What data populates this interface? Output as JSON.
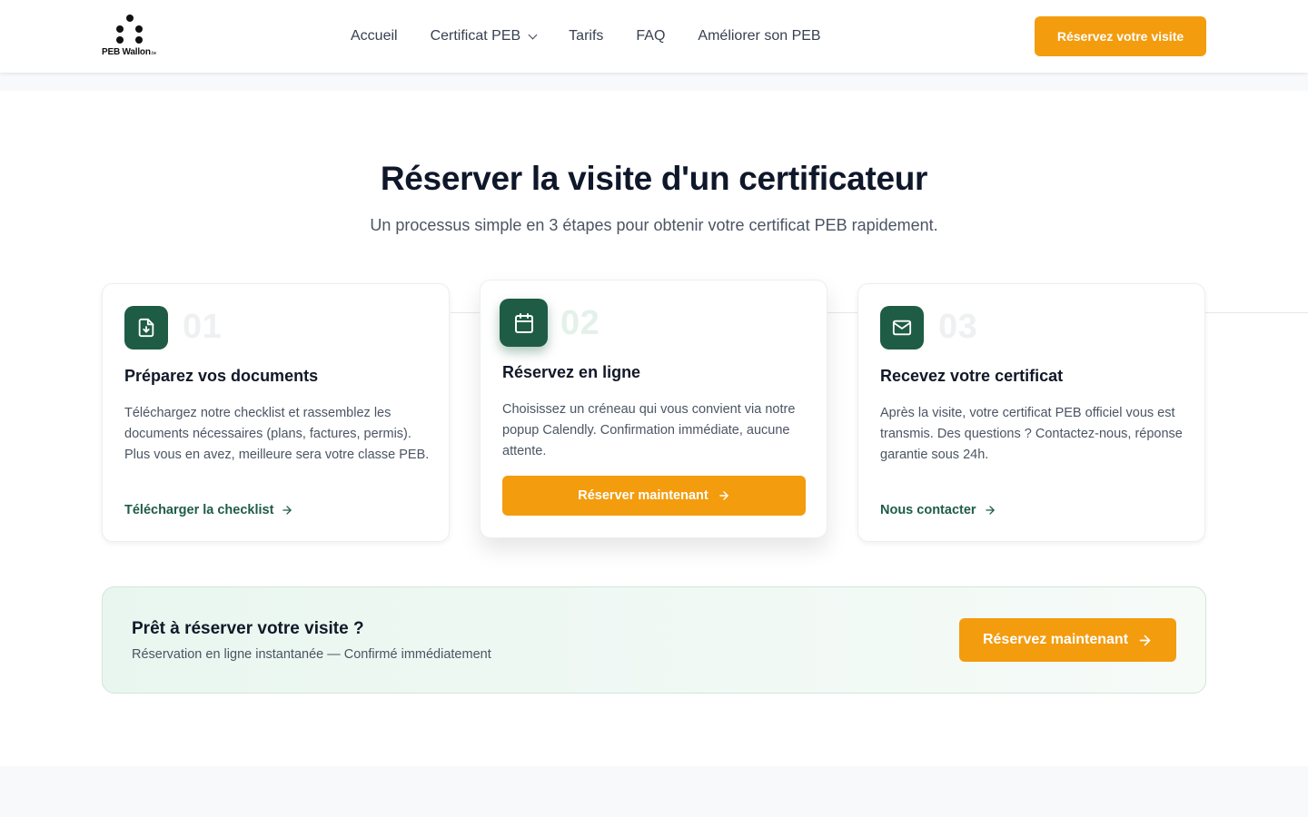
{
  "header": {
    "logo_text": "PEB Wallon",
    "logo_suffix": ".be",
    "nav": [
      {
        "label": "Accueil"
      },
      {
        "label": "Certificat PEB",
        "has_dropdown": true
      },
      {
        "label": "Tarifs"
      },
      {
        "label": "FAQ"
      },
      {
        "label": "Améliorer son PEB"
      }
    ],
    "cta_label": "Réservez votre visite"
  },
  "section": {
    "title": "Réserver la visite d'un certificateur",
    "subtitle": "Un processus simple en 3 étapes pour obtenir votre certificat PEB rapidement."
  },
  "steps": [
    {
      "number": "01",
      "icon": "file-download-icon",
      "title": "Préparez vos documents",
      "description": "Téléchargez notre checklist et rassemblez les documents nécessaires (plans, factures, permis). Plus vous en avez, meilleure sera votre classe PEB.",
      "link_label": "Télécharger la checklist"
    },
    {
      "number": "02",
      "icon": "calendar-icon",
      "title": "Réservez en ligne",
      "description": "Choisissez un créneau qui vous convient via notre popup Calendly. Confirmation immédiate, aucune attente.",
      "button_label": "Réserver maintenant"
    },
    {
      "number": "03",
      "icon": "mail-icon",
      "title": "Recevez votre certificat",
      "description": "Après la visite, votre certificat PEB officiel vous est transmis. Des questions ? Contactez-nous, réponse garantie sous 24h.",
      "link_label": "Nous contacter"
    }
  ],
  "cta": {
    "title": "Prêt à réserver votre visite ?",
    "subtitle": "Réservation en ligne instantanée — Confirmé immédiatement",
    "button_label": "Réservez maintenant"
  },
  "colors": {
    "brand_green": "#1e5c45",
    "accent_orange": "#f39c0e",
    "heading": "#0f172a",
    "body_text": "#4b5563"
  }
}
